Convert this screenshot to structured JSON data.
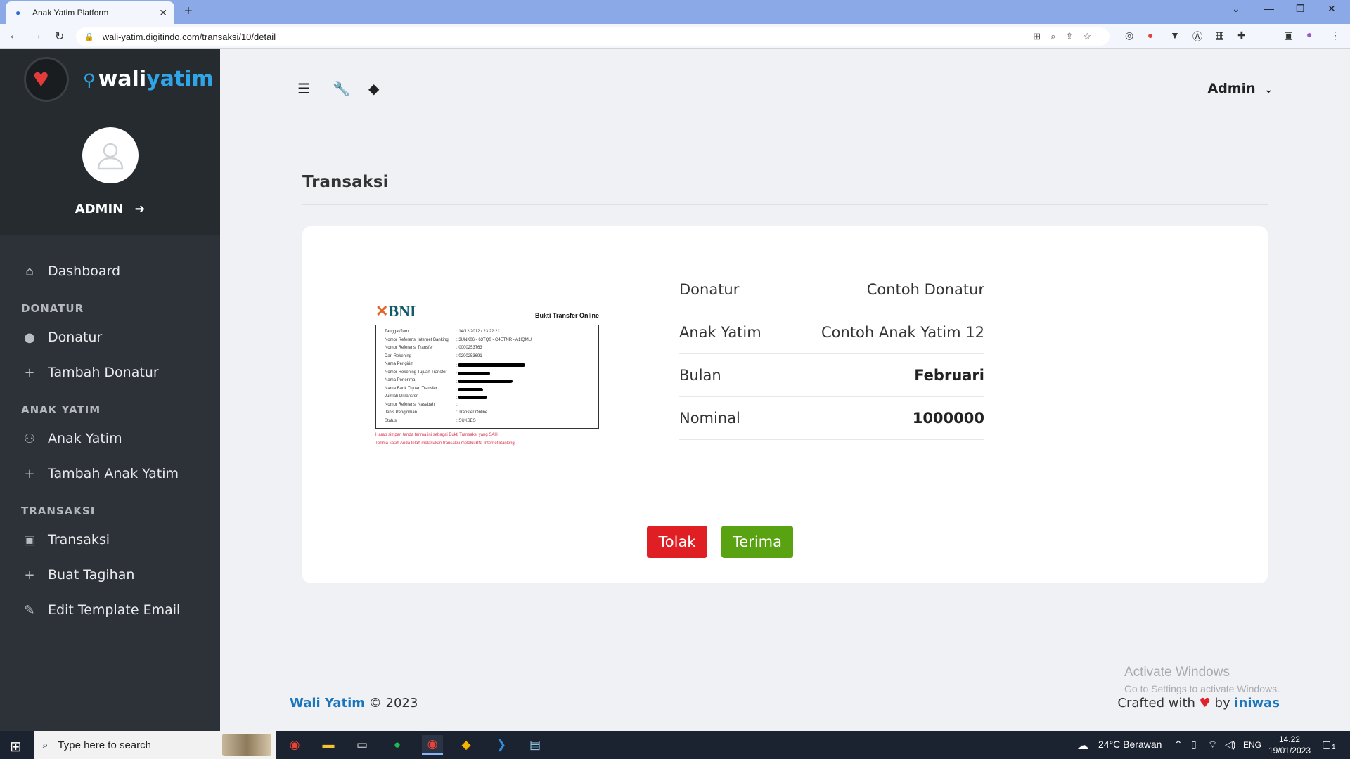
{
  "browser": {
    "tab_title": "Anak Yatim Platform",
    "url": "wali-yatim.digitindo.com/transaksi/10/detail"
  },
  "sidebar": {
    "brand_part1": "wali",
    "brand_part2": "yatim",
    "username": "ADMIN",
    "items": [
      {
        "label": "Dashboard",
        "icon": "home-icon"
      },
      {
        "section": "DONATUR"
      },
      {
        "label": "Donatur",
        "icon": "user-icon"
      },
      {
        "label": "Tambah Donatur",
        "icon": "plus-icon"
      },
      {
        "section": "ANAK YATIM"
      },
      {
        "label": "Anak Yatim",
        "icon": "children-icon"
      },
      {
        "label": "Tambah Anak Yatim",
        "icon": "plus-icon"
      },
      {
        "section": "TRANSAKSI"
      },
      {
        "label": "Transaksi",
        "icon": "money-icon"
      },
      {
        "label": "Buat Tagihan",
        "icon": "plus-icon"
      },
      {
        "label": "Edit Template Email",
        "icon": "pencil-icon"
      }
    ]
  },
  "topbar": {
    "user": "Admin"
  },
  "page": {
    "title": "Transaksi"
  },
  "receipt": {
    "bank": "BNI",
    "heading": "Bukti Transfer Online",
    "rows": [
      {
        "k": "Tanggal/Jam",
        "v": ": 14/12/2012 / 23:22:21"
      },
      {
        "k": "Nomor Referensi Internet Banking",
        "v": ": 3UNK06 - 63TQ0 - C4ETNR - A1IQMU"
      },
      {
        "k": "Nomor Referensi Transfer",
        "v": ": 0000253763"
      },
      {
        "k": "Dari Rekening",
        "v": ": 0200253691"
      },
      {
        "k": "Nama Pengirim",
        "v": ":"
      },
      {
        "k": "Nomor Rekening Tujuan Transfer",
        "v": ":"
      },
      {
        "k": "Nama Penerima",
        "v": ":"
      },
      {
        "k": "Nama Bank Tujuan Transfer",
        "v": ":"
      },
      {
        "k": "Jumlah Ditransfer",
        "v": ":"
      },
      {
        "k": "Nomor Referensi Nasabah",
        "v": ":"
      },
      {
        "k": "Jenis Pengiriman",
        "v": ": Transfer Online"
      },
      {
        "k": "Status",
        "v": ": SUKSES"
      }
    ],
    "note1": "Harap simpan tanda terima ini sebagai Bukti Transaksi yang SAH",
    "note2": "Terima kasih Anda telah melakukan transaksi melalui BNI Internet Banking"
  },
  "details": {
    "donatur_label": "Donatur",
    "donatur_value": "Contoh Donatur",
    "anak_label": "Anak Yatim",
    "anak_value": "Contoh Anak Yatim 12",
    "bulan_label": "Bulan",
    "bulan_value": "Februari",
    "nominal_label": "Nominal",
    "nominal_value": "1000000"
  },
  "actions": {
    "reject": "Tolak",
    "accept": "Terima"
  },
  "footer": {
    "brand": "Wali Yatim",
    "copyright": "© 2023",
    "crafted": "Crafted with",
    "by": "by",
    "author": "iniwas"
  },
  "watermark": {
    "line1": "Activate Windows",
    "line2": "Go to Settings to activate Windows."
  },
  "taskbar": {
    "search_placeholder": "Type here to search",
    "weather": "24°C  Berawan",
    "lang": "ENG",
    "time": "14.22",
    "date": "19/01/2023",
    "notif_count": "1"
  },
  "colors": {
    "sidebar_bg": "#2d3238",
    "brand_blue": "#2fa5e8",
    "reject_red": "#e01f24",
    "accept_green": "#59a313",
    "link_blue": "#1b75bb"
  }
}
